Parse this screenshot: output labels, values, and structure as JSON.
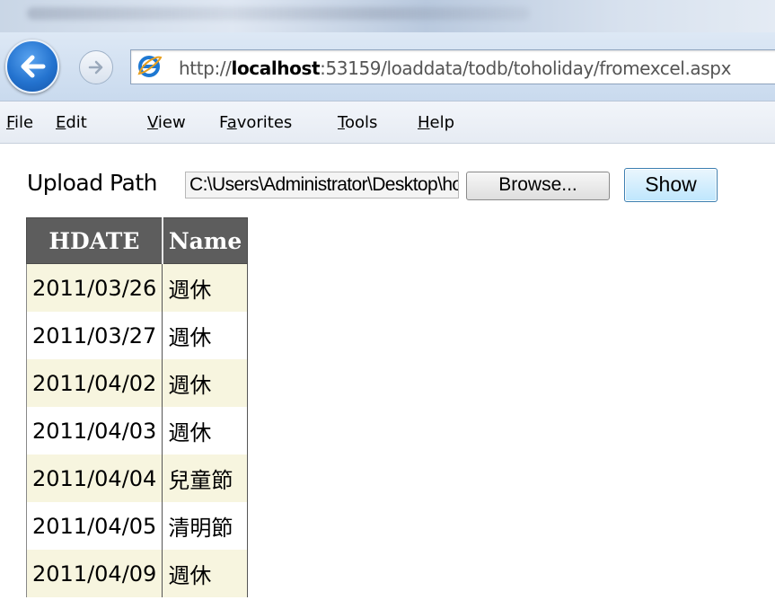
{
  "browser": {
    "url_prefix": "http://",
    "url_host": "localhost",
    "url_rest": ":53159/loaddata/todb/toholiday/fromexcel.aspx",
    "menu": [
      {
        "label": "File",
        "accel": "F",
        "rest": "ile"
      },
      {
        "label": "Edit",
        "accel": "E",
        "rest": "dit"
      },
      {
        "label": "View",
        "accel": "V",
        "rest": "iew"
      },
      {
        "label": "Favorites",
        "pre": "F",
        "accel": "a",
        "rest": "vorites"
      },
      {
        "label": "Tools",
        "accel": "T",
        "rest": "ools"
      },
      {
        "label": "Help",
        "accel": "H",
        "rest": "elp"
      }
    ]
  },
  "form": {
    "upload_label": "Upload Path",
    "file_value": "C:\\Users\\Administrator\\Desktop\\holiday.xls",
    "browse_label": "Browse...",
    "show_label": "Show"
  },
  "table": {
    "headers": [
      "HDATE",
      "Name"
    ],
    "rows": [
      [
        "2011/03/26",
        "週休"
      ],
      [
        "2011/03/27",
        "週休"
      ],
      [
        "2011/04/02",
        "週休"
      ],
      [
        "2011/04/03",
        "週休"
      ],
      [
        "2011/04/04",
        "兒童節"
      ],
      [
        "2011/04/05",
        "清明節"
      ],
      [
        "2011/04/09",
        "週休"
      ]
    ]
  }
}
